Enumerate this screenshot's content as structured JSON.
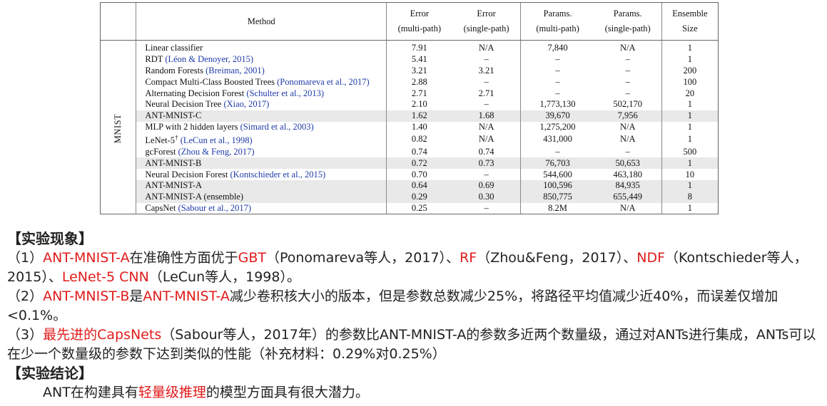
{
  "table": {
    "headers": {
      "method": "Method",
      "err_multi_1": "Error",
      "err_multi_2": "(multi-path)",
      "err_single_1": "Error",
      "err_single_2": "(single-path)",
      "par_multi_1": "Params.",
      "par_multi_2": "(multi-path)",
      "par_single_1": "Params.",
      "par_single_2": "(single-path)",
      "ens_1": "Ensemble",
      "ens_2": "Size"
    },
    "group_label": "MNIST",
    "rows": [
      {
        "method": "Linear classifier",
        "cite": "",
        "sup": "",
        "err_multi": "7.91",
        "err_single": "N/A",
        "par_multi": "7,840",
        "par_single": "N/A",
        "ensemble": "1"
      },
      {
        "method": "RDT ",
        "cite": "(Léon & Denoyer, 2015)",
        "sup": "",
        "err_multi": "5.41",
        "err_single": "–",
        "par_multi": "–",
        "par_single": "–",
        "ensemble": "1"
      },
      {
        "method": "Random Forests ",
        "cite": "(Breiman, 2001)",
        "sup": "",
        "err_multi": "3.21",
        "err_single": "3.21",
        "par_multi": "–",
        "par_single": "–",
        "ensemble": "200"
      },
      {
        "method": "Compact Multi-Class Boosted Trees ",
        "cite": "(Ponomareva et al., 2017)",
        "sup": "",
        "err_multi": "2.88",
        "err_single": "–",
        "par_multi": "–",
        "par_single": "–",
        "ensemble": "100"
      },
      {
        "method": "Alternating Decision Forest ",
        "cite": "(Schulter et al., 2013)",
        "sup": "",
        "err_multi": "2.71",
        "err_single": "2.71",
        "par_multi": "–",
        "par_single": "–",
        "ensemble": "20"
      },
      {
        "method": "Neural Decision Tree ",
        "cite": "(Xiao, 2017)",
        "sup": "",
        "err_multi": "2.10",
        "err_single": "–",
        "par_multi": "1,773,130",
        "par_single": "502,170",
        "ensemble": "1"
      },
      {
        "method": "ANT-MNIST-C",
        "cite": "",
        "sup": "",
        "err_multi": "1.62",
        "err_single": "1.68",
        "par_multi": "39,670",
        "par_single": "7,956",
        "ensemble": "1"
      },
      {
        "method": "MLP with 2 hidden layers ",
        "cite": "(Simard et al., 2003)",
        "sup": "",
        "err_multi": "1.40",
        "err_single": "N/A",
        "par_multi": "1,275,200",
        "par_single": "N/A",
        "ensemble": "1"
      },
      {
        "method": "LeNet-5",
        "cite": "(LeCun et al., 1998)",
        "sup": "†",
        "err_multi": "0.82",
        "err_single": "N/A",
        "par_multi": "431,000",
        "par_single": "N/A",
        "ensemble": "1"
      },
      {
        "method": "gcForest ",
        "cite": "(Zhou & Feng, 2017)",
        "sup": "",
        "err_multi": "0.74",
        "err_single": "0.74",
        "par_multi": "–",
        "par_single": "–",
        "ensemble": "500"
      },
      {
        "method": "ANT-MNIST-B",
        "cite": "",
        "sup": "",
        "err_multi": "0.72",
        "err_single": "0.73",
        "par_multi": "76,703",
        "par_single": "50,653",
        "ensemble": "1"
      },
      {
        "method": "Neural Decision Forest ",
        "cite": "(Kontschieder et al., 2015)",
        "sup": "",
        "err_multi": "0.70",
        "err_single": "–",
        "par_multi": "544,600",
        "par_single": "463,180",
        "ensemble": "10"
      },
      {
        "method": "ANT-MNIST-A",
        "cite": "",
        "sup": "",
        "err_multi": "0.64",
        "err_single": "0.69",
        "par_multi": "100,596",
        "par_single": "84,935",
        "ensemble": "1"
      },
      {
        "method": "ANT-MNIST-A (ensemble)",
        "cite": "",
        "sup": "",
        "err_multi": "0.29",
        "err_single": "0.30",
        "par_multi": "850,775",
        "par_single": "655,449",
        "ensemble": "8"
      },
      {
        "method": "CapsNet ",
        "cite": "(Sabour et al., 2017)",
        "sup": "",
        "err_multi": "0.25",
        "err_single": "–",
        "par_multi": "8.2M",
        "par_single": "N/A",
        "ensemble": "1"
      }
    ],
    "shaded_rows": [
      6,
      10,
      12,
      13
    ]
  },
  "notes": {
    "phenomenon_heading": "【实验现象】",
    "p1": [
      {
        "t": "（1）",
        "red": false
      },
      {
        "t": "ANT-MNIST-A",
        "red": true
      },
      {
        "t": "在准确性方面优于",
        "red": false
      },
      {
        "t": "GBT",
        "red": true
      },
      {
        "t": "（Ponomareva等人，2017）、",
        "red": false
      },
      {
        "t": "RF",
        "red": true
      },
      {
        "t": "（Zhou&Feng，2017）、",
        "red": false
      },
      {
        "t": "NDF",
        "red": true
      },
      {
        "t": "（Kontschieder等人，2015）、",
        "red": false
      },
      {
        "t": "LeNet-5 CNN",
        "red": true
      },
      {
        "t": "（LeCun等人，1998）。",
        "red": false
      }
    ],
    "p2": [
      {
        "t": "（2）",
        "red": false
      },
      {
        "t": "ANT-MNIST-B",
        "red": true
      },
      {
        "t": "是",
        "red": false
      },
      {
        "t": "ANT-MNIST-A",
        "red": true
      },
      {
        "t": "减少卷积核大小的版本，但是参数总数减少25%，将路径平均值减少近40%，而误差仅增加<0.1%。",
        "red": false
      }
    ],
    "p3": [
      {
        "t": "（3）",
        "red": false
      },
      {
        "t": "最先进的CapsNets",
        "red": true
      },
      {
        "t": "（Sabour等人，2017年）的参数比ANT-MNIST-A的参数多近两个数量级，通过对ANTs进行集成，ANTs可以在少一个数量级的参数下达到类似的性能（补充材料：0.29%对0.25%）",
        "red": false
      }
    ],
    "conclusion_heading": "【实验结论】",
    "p4": [
      {
        "t": "ANT在构建具有",
        "red": false
      },
      {
        "t": "轻量级推理",
        "red": true
      },
      {
        "t": "的模型方面具有很大潜力。",
        "red": false
      }
    ]
  },
  "colors": {
    "accent_red": "#e21b1b",
    "citation_blue": "#1f3aa8",
    "row_shade": "#e9e9e9"
  }
}
